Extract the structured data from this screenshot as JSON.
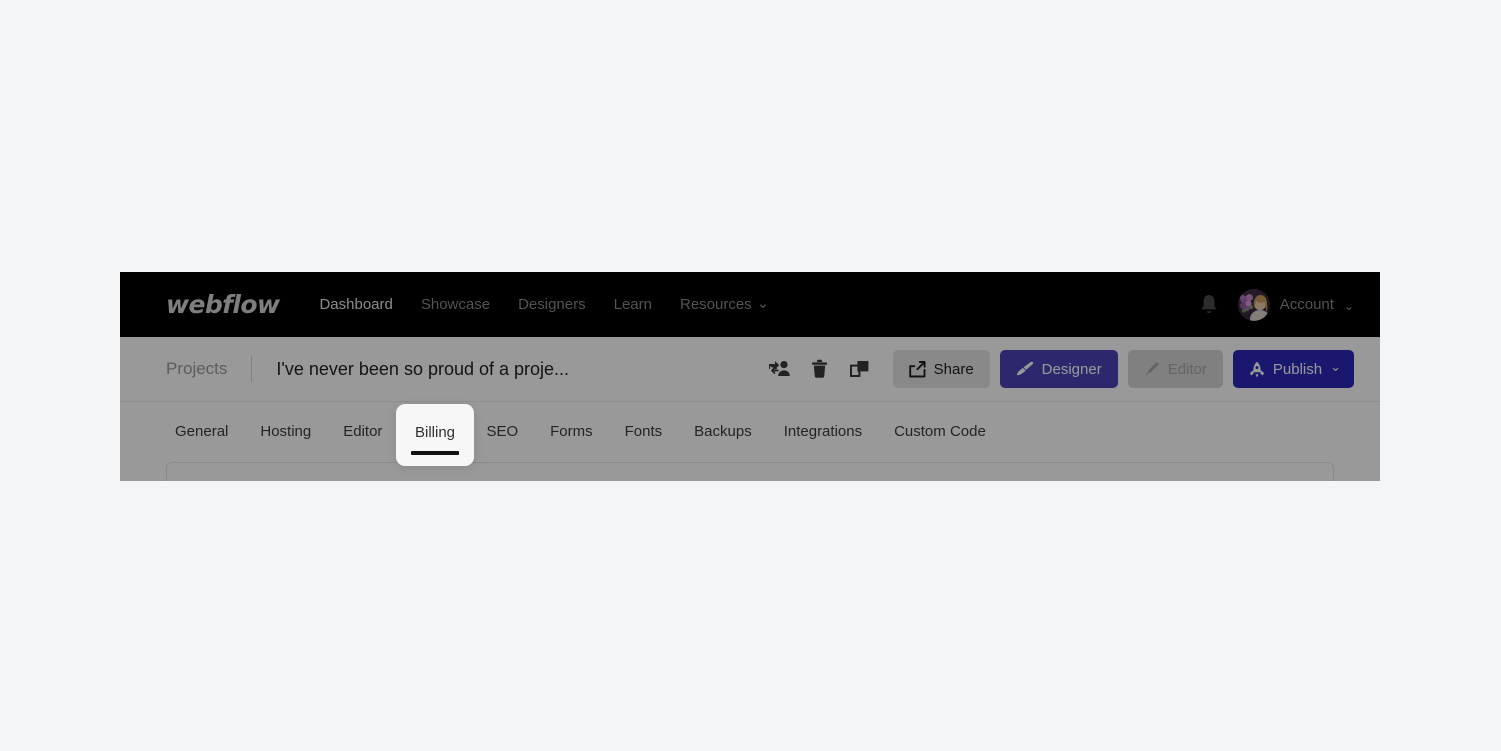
{
  "page": {
    "background_color": "#f4f5f7",
    "overlay_color": "rgba(0,0,0,0.40)"
  },
  "topnav": {
    "brand": "webflow",
    "brand_color": "#d2d2d2",
    "background_color": "#000000",
    "links": [
      {
        "label": "Dashboard",
        "active": true
      },
      {
        "label": "Showcase",
        "active": false
      },
      {
        "label": "Designers",
        "active": false
      },
      {
        "label": "Learn",
        "active": false
      },
      {
        "label": "Resources",
        "active": false,
        "chevron": "⌄"
      }
    ],
    "bell_icon": "bell-icon",
    "account": {
      "label": "Account",
      "chevron": "⌄",
      "avatar_icon": "avatar-photo"
    }
  },
  "subheader": {
    "breadcrumb": "Projects",
    "project_title": "I've never been so proud of a proje...",
    "icons": [
      {
        "name": "transfer-project-icon",
        "title": "Transfer project"
      },
      {
        "name": "delete-project-icon",
        "title": "Delete project"
      },
      {
        "name": "duplicate-project-icon",
        "title": "Duplicate project"
      }
    ],
    "buttons": {
      "share": {
        "label": "Share",
        "icon": "share-icon",
        "color": "#e4e4e4"
      },
      "designer": {
        "label": "Designer",
        "icon": "paintbrush-icon",
        "color": "#4b44b8"
      },
      "editor": {
        "label": "Editor",
        "icon": "pencil-icon",
        "color": "#d5d5d5",
        "disabled": true
      },
      "publish": {
        "label": "Publish",
        "icon": "rocket-icon",
        "chevron": "⌄",
        "color": "#2a27b8"
      }
    }
  },
  "tabs": {
    "items": [
      {
        "label": "General"
      },
      {
        "label": "Hosting"
      },
      {
        "label": "Editor"
      },
      {
        "label": "Billing"
      },
      {
        "label": "SEO"
      },
      {
        "label": "Forms"
      },
      {
        "label": "Fonts"
      },
      {
        "label": "Backups"
      },
      {
        "label": "Integrations"
      },
      {
        "label": "Custom Code"
      }
    ],
    "highlighted": "Billing"
  },
  "spotlight": {
    "label": "Billing",
    "underline_color": "#111111",
    "card_color": "#f7f7f7"
  }
}
